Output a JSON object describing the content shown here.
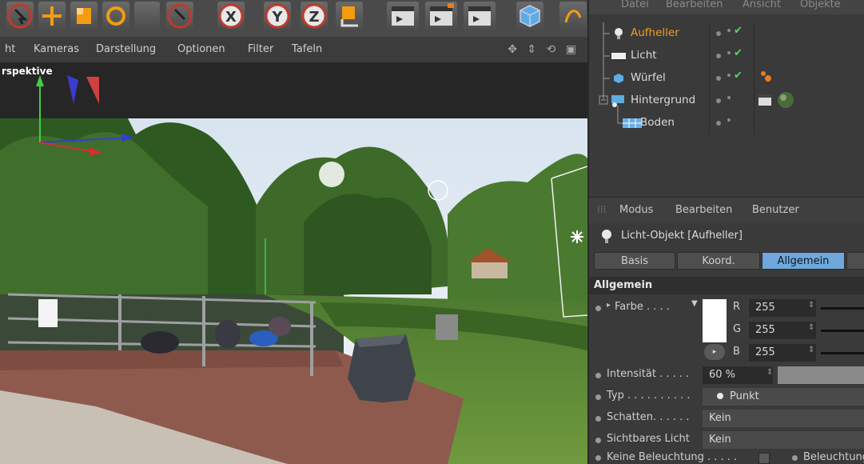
{
  "viewport_menu": {
    "items": [
      "ht",
      "Kameras",
      "Darstellung",
      "Optionen",
      "Filter",
      "Tafeln"
    ],
    "view_label": "rspektive"
  },
  "object_manager": {
    "header": [
      "Datei",
      "Bearbeiten",
      "Ansicht",
      "Objekte"
    ],
    "objects": [
      {
        "name": "Aufheller",
        "selected": true,
        "color": "#f0a020"
      },
      {
        "name": "Licht",
        "selected": false,
        "color": "#dcdcdc"
      },
      {
        "name": "Würfel",
        "selected": false,
        "color": "#dcdcdc"
      },
      {
        "name": "Hintergrund",
        "selected": false,
        "color": "#dcdcdc"
      },
      {
        "name": "Boden",
        "selected": false,
        "color": "#dcdcdc"
      }
    ]
  },
  "attribute_manager": {
    "menu": [
      "Modus",
      "Bearbeiten",
      "Benutzer"
    ],
    "title": "Licht-Objekt [Aufheller]",
    "tabs": [
      "Basis",
      "Koord.",
      "Allgemein"
    ],
    "active_tab": "Allgemein",
    "section": "Allgemein",
    "color": {
      "label": "Farbe . . . .",
      "r_label": "R",
      "g_label": "G",
      "b_label": "B",
      "r": "255",
      "g": "255",
      "b": "255"
    },
    "intensity": {
      "label": "Intensität . . . . .",
      "value": "60 %"
    },
    "type": {
      "label": "Typ . . . . . . . . . .",
      "value": "Punkt"
    },
    "shadow": {
      "label": "Schatten. . . . . .",
      "value": "Kein"
    },
    "visible_light": {
      "label": "Sichtbares Licht",
      "value": "Kein"
    },
    "no_lighting": {
      "label": "Keine Beleuchtung . . . . .",
      "right_label": "Beleuchtung"
    }
  },
  "colors": {
    "accent_tab": "#6fa8dc",
    "selected_object": "#f0a020",
    "check": "#5fd35f"
  }
}
